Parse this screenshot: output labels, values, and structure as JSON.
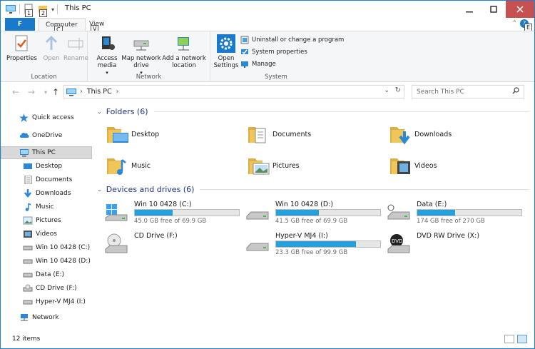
{
  "window": {
    "title": "This PC"
  },
  "ribbon_tabs": {
    "file": "F",
    "computer": "Computer",
    "view": "View",
    "computer_keytip": "C",
    "view_keytip": "V",
    "help_keytip": "E"
  },
  "qat_keytips": [
    "1",
    "2"
  ],
  "ribbon": {
    "location": {
      "label": "Location",
      "properties": "Properties",
      "open": "Open",
      "rename": "Rename"
    },
    "network": {
      "label": "Network",
      "access_media": "Access media",
      "map_drive": "Map network drive",
      "add_location": "Add a network location"
    },
    "system": {
      "label": "System",
      "open_settings": "Open Settings",
      "uninstall": "Uninstall or change a program",
      "sys_props": "System properties",
      "manage": "Manage"
    }
  },
  "address": {
    "path_root": "This PC",
    "search_placeholder": "Search This PC"
  },
  "nav": {
    "quick_access": "Quick access",
    "onedrive": "OneDrive",
    "this_pc": "This PC",
    "children": [
      "Desktop",
      "Documents",
      "Downloads",
      "Music",
      "Pictures",
      "Videos",
      "Win 10 0428 (C:)",
      "Win 10 0428 (D:)",
      "Data (E:)",
      "CD Drive (F:)",
      "Hyper-V MJ4 (I:)"
    ],
    "network": "Network"
  },
  "content": {
    "folders_header": "Folders (6)",
    "folders": [
      "Desktop",
      "Documents",
      "Downloads",
      "Music",
      "Pictures",
      "Videos"
    ],
    "drives_header": "Devices and drives (6)",
    "drives": [
      {
        "name": "Win 10 0428 (C:)",
        "free": "45.0 GB free of 69.9 GB",
        "used_fraction": 0.36
      },
      {
        "name": "Win 10 0428 (D:)",
        "free": "41.5 GB free of 69.9 GB",
        "used_fraction": 0.41
      },
      {
        "name": "Data (E:)",
        "free": "174 GB free of 270 GB",
        "used_fraction": 0.36
      },
      {
        "name": "CD Drive (F:)"
      },
      {
        "name": "Hyper-V MJ4 (I:)",
        "free": "23.3 GB free of 99.9 GB",
        "used_fraction": 0.77
      },
      {
        "name": "DVD RW Drive (X:)"
      }
    ]
  },
  "status": {
    "items": "12 items"
  },
  "colors": {
    "accent": "#1979ca",
    "close": "#c75050",
    "bar_fill": "#26a0da",
    "folder": "#f0c65b"
  }
}
